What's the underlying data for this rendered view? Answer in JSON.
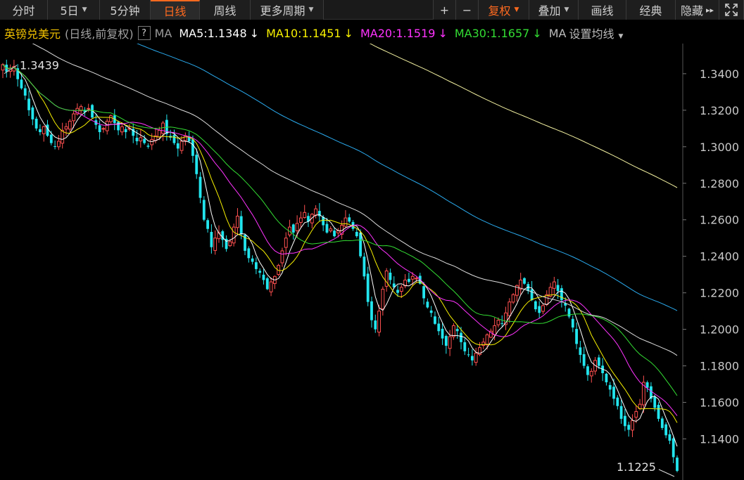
{
  "toolbar": {
    "items": [
      {
        "label": "分时",
        "dropdown": false,
        "active": false,
        "w": 68
      },
      {
        "label": "5日",
        "dropdown": true,
        "active": false,
        "w": 74
      },
      {
        "label": "5分钟",
        "dropdown": false,
        "active": false,
        "w": 72
      },
      {
        "label": "日线",
        "dropdown": false,
        "active": true,
        "w": 70
      },
      {
        "label": "周线",
        "dropdown": false,
        "active": false,
        "w": 72
      },
      {
        "label": "更多周期",
        "dropdown": true,
        "active": false,
        "w": 104
      }
    ],
    "right": [
      {
        "label": "+",
        "dropdown": false,
        "w": 32
      },
      {
        "label": "−",
        "dropdown": false,
        "w": 32
      },
      {
        "label": "复权",
        "dropdown": true,
        "w": 72,
        "accent": true
      },
      {
        "label": "叠加",
        "dropdown": true,
        "w": 70
      },
      {
        "label": "画线",
        "dropdown": false,
        "w": 68
      },
      {
        "label": "经典",
        "dropdown": false,
        "w": 70
      },
      {
        "label": "隐藏",
        "dropdown": false,
        "w": 62,
        "icon": "double-chevron-right-icon"
      },
      {
        "label": "",
        "dropdown": false,
        "w": 35,
        "icon": "fullscreen-icon"
      }
    ]
  },
  "legend": {
    "symbol": "英镑兑美元",
    "mode": "(日线,前复权)",
    "help": "?",
    "ma_label": "MA",
    "settings": "设置均线",
    "mas": [
      {
        "name": "MA5",
        "text": "MA5:1.1348",
        "arrow": "↓",
        "color": "#ffffff"
      },
      {
        "name": "MA10",
        "text": "MA10:1.1451",
        "arrow": "↓",
        "color": "#f7f000"
      },
      {
        "name": "MA20",
        "text": "MA20:1.1519",
        "arrow": "↓",
        "color": "#ff33ff"
      },
      {
        "name": "MA30",
        "text": "MA30:1.1657",
        "arrow": "↓",
        "color": "#33dd33"
      },
      {
        "name": "MA-more",
        "text": "MA",
        "arrow": "",
        "color": "#bbbbbb"
      }
    ]
  },
  "chart_data": {
    "type": "candlestick",
    "ylim": [
      1.1175,
      1.3565
    ],
    "yticks": [
      1.34,
      1.32,
      1.3,
      1.28,
      1.26,
      1.24,
      1.22,
      1.2,
      1.18,
      1.16,
      1.14
    ],
    "ytick_labels": [
      "1.3400",
      "1.3200",
      "1.3000",
      "1.2800",
      "1.2600",
      "1.2400",
      "1.2200",
      "1.2000",
      "1.1800",
      "1.1600",
      "1.1400"
    ],
    "max_label": "1.3439",
    "min_label": "1.1225",
    "max_value": 1.3439,
    "min_value": 1.1225,
    "up_color": "#ff5050",
    "down_color": "#22e5ee",
    "closes": [
      1.345,
      1.341,
      1.343,
      1.344,
      1.337,
      1.332,
      1.328,
      1.32,
      1.315,
      1.31,
      1.308,
      1.311,
      1.306,
      1.302,
      1.3,
      1.303,
      1.309,
      1.311,
      1.314,
      1.318,
      1.321,
      1.322,
      1.319,
      1.321,
      1.316,
      1.312,
      1.308,
      1.31,
      1.314,
      1.317,
      1.313,
      1.309,
      1.311,
      1.308,
      1.31,
      1.306,
      1.303,
      1.305,
      1.302,
      1.3,
      1.304,
      1.306,
      1.309,
      1.313,
      1.307,
      1.305,
      1.302,
      1.299,
      1.303,
      1.306,
      1.303,
      1.295,
      1.285,
      1.272,
      1.26,
      1.255,
      1.245,
      1.25,
      1.253,
      1.249,
      1.244,
      1.248,
      1.256,
      1.262,
      1.252,
      1.243,
      1.239,
      1.237,
      1.233,
      1.231,
      1.227,
      1.222,
      1.226,
      1.229,
      1.235,
      1.243,
      1.25,
      1.256,
      1.253,
      1.258,
      1.261,
      1.264,
      1.259,
      1.263,
      1.266,
      1.262,
      1.257,
      1.253,
      1.255,
      1.251,
      1.254,
      1.257,
      1.261,
      1.259,
      1.255,
      1.251,
      1.24,
      1.229,
      1.215,
      1.205,
      1.2,
      1.21,
      1.222,
      1.232,
      1.227,
      1.223,
      1.22,
      1.223,
      1.227,
      1.226,
      1.229,
      1.228,
      1.225,
      1.217,
      1.212,
      1.209,
      1.203,
      1.199,
      1.195,
      1.191,
      1.196,
      1.202,
      1.199,
      1.193,
      1.188,
      1.186,
      1.183,
      1.187,
      1.19,
      1.193,
      1.197,
      1.199,
      1.202,
      1.205,
      1.203,
      1.209,
      1.215,
      1.219,
      1.224,
      1.227,
      1.225,
      1.221,
      1.216,
      1.211,
      1.209,
      1.213,
      1.219,
      1.223,
      1.226,
      1.221,
      1.216,
      1.213,
      1.207,
      1.201,
      1.192,
      1.186,
      1.18,
      1.175,
      1.177,
      1.183,
      1.18,
      1.176,
      1.171,
      1.167,
      1.162,
      1.158,
      1.151,
      1.147,
      1.145,
      1.15,
      1.155,
      1.159,
      1.171,
      1.168,
      1.162,
      1.157,
      1.151,
      1.146,
      1.142,
      1.139,
      1.13,
      1.1225
    ],
    "ma5_last": 1.1348,
    "ma10_last": 1.1451,
    "ma20_last": 1.1519,
    "ma30_last": 1.1657,
    "ma_long_colors": [
      "#dddddd",
      "#2aaaee",
      "#f2f0a0"
    ]
  }
}
